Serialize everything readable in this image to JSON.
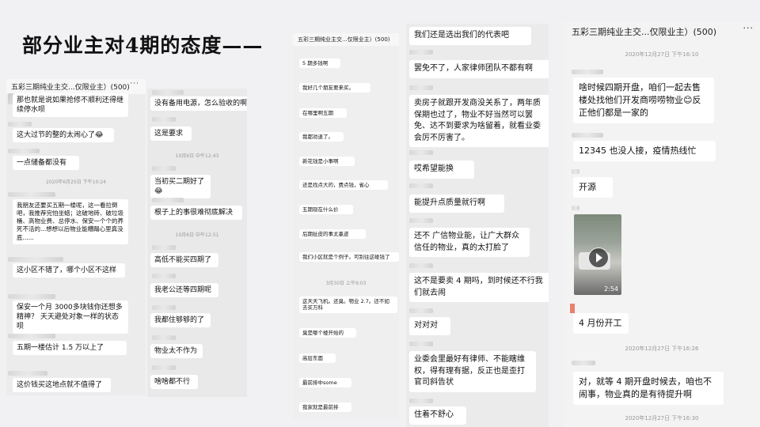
{
  "slide": {
    "title": "部分业主对4期的态度——"
  },
  "group_title_short": "五彩三期纯业主交...仅限业主）(500)",
  "group_title_long": "五彩三期纯业主交...仅限业主）(500)",
  "more_glyph": "···",
  "panel1": {
    "messages": [
      "那也就是说如果抢修不顺利还得继续停水呗",
      "这大过节的整的太闹心了😂",
      "一点储备都没有",
      "我朋友还要买五期一楼呢，这一看拉倒吧，我推荐完怕坐蜡；这破地砖、破垃圾桶、高物业费、总停水、保安一个个的养死不活的...想想以后物业能糟蹋心里真没底......",
      "这小区不错了，哪个小区不这样",
      "保安一个月 3000多块钱你还想多精神？ 天天避处对象一样的状态呗",
      "五期一楼估计 1.5 万以上了",
      "这价钱买这地点就不值得了"
    ],
    "timestamp": "2020年6月25日 下午10:24"
  },
  "panel2": {
    "messages": [
      "没有备用电源，怎么验收的啊",
      "这是要求",
      "当初买二期好了😂",
      "根子上的事很难彻底解决",
      "高低不能买四期了",
      "我老公还等四期呢",
      "我都住够够的了",
      "物业太不作为",
      "啥啥都不行"
    ],
    "timestamps": [
      "10月6日 中午12:43",
      "10月6日 中午12:51"
    ]
  },
  "panel3": {
    "messages": [
      "5 期多钱啊",
      "我好几个朋友要来买。",
      "在哪里啊五期",
      "我都劝退了。",
      "新花钱是小事啊",
      "还是找点大的，费点钱，省心",
      "五期现在什么价",
      "后期扯皮的事太墨迹",
      "我们小区就是个例子。可别往这碰钱了",
      "这天天飞机。还臭。物业 2.7。还不如去买万科",
      "臭是哪个楼开始的",
      "高层东面",
      "最前排中some",
      "我家就是最前排"
    ],
    "timestamp": "3月30日 上午9:03"
  },
  "panel4": {
    "messages": [
      "我们还是选出我们的代表吧",
      "罢免不了，人家律师团队不都有啊",
      "卖房子就跟开发商没关系了，两年质保期也过了，物业不好当然可以罢免、达不到要求为啥留着，就看业委会厉不厉害了。",
      "哎希望能换",
      "能提升点质量就行啊",
      "还不 广信物业能，让广大群众信任的物业，真的太打脸了",
      "这不是要卖 4 期吗，到时候还不行我们就去闹",
      "对对对",
      "业委会里最好有律师、不能瞎维权，得有理有据，反正也是歪打官司斜告状",
      "住着不舒心"
    ]
  },
  "panel5": {
    "title": "五彩三期纯业主交...仅限业主）(500)",
    "timestamps": [
      "2020年12月27日 下午16:10",
      "2020年12月27日 下午16:26",
      "2020年12月27日 下午16:30"
    ],
    "messages": [
      "啥时候四期开盘，咱们一起去售楼处找他们开发商唠唠物业😊反正他们都是一家的",
      "12345 也没人接，疫情热线忙",
      "开源",
      "4 月份开工",
      "对，就等 4 期开盘时候去，咱也不闹事，物业真的是有待提升啊"
    ],
    "video_duration": "2:54"
  }
}
